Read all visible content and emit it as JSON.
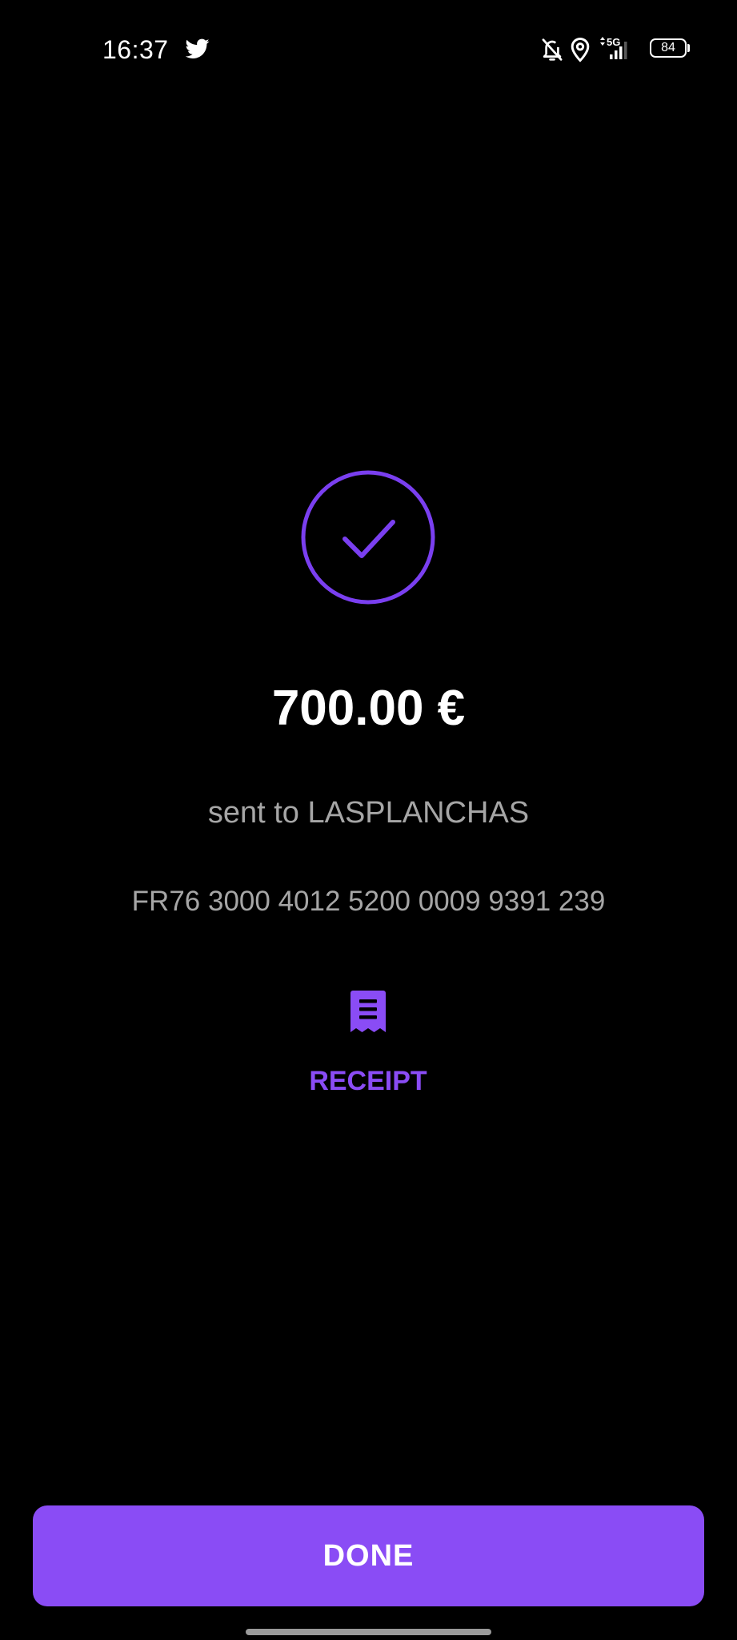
{
  "status_bar": {
    "time": "16:37",
    "battery_level": "84",
    "network": "5G",
    "icons": [
      "twitter-icon",
      "bell-off-icon",
      "location-icon",
      "signal-icon",
      "battery-icon"
    ]
  },
  "confirmation": {
    "amount": "700.00 €",
    "recipient": "sent to LASPLANCHAS",
    "iban": "FR76 3000 4012 5200 0009 9391 239",
    "icon": "check-circle-icon"
  },
  "receipt": {
    "label": "RECEIPT",
    "icon": "receipt-icon"
  },
  "footer": {
    "done_label": "DONE"
  },
  "colors": {
    "background": "#000000",
    "accent": "#8a4cf5",
    "check_ring": "#7a3ff0",
    "secondary_text": "#a6a6a6",
    "primary_text": "#ffffff"
  }
}
